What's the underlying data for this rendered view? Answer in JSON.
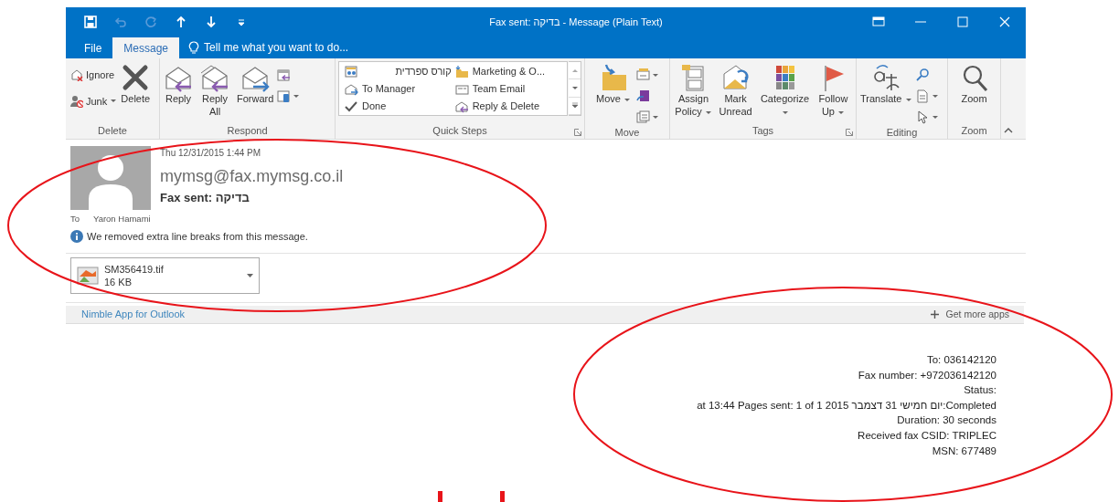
{
  "window": {
    "title": "Fax sent: בדיקה - Message (Plain Text)"
  },
  "quick_access": [
    {
      "disabled": false
    },
    {
      "disabled": true
    },
    {
      "disabled": true
    },
    {
      "disabled": false
    },
    {
      "disabled": false
    },
    {
      "disabled": false
    }
  ],
  "tabs": [
    {
      "label": "File",
      "selected": false
    },
    {
      "label": "Message",
      "selected": true
    }
  ],
  "tell_me": {
    "placeholder": "Tell me what you want to do..."
  },
  "ribbon": {
    "groups": [
      {
        "label": "Delete",
        "items": [
          {
            "kind": "smallstack",
            "items": [
              {
                "label": "Ignore",
                "dropdown": false
              },
              {
                "label": "Junk",
                "dropdown": true
              }
            ]
          },
          {
            "kind": "large",
            "label": "Delete",
            "dropdown": false
          }
        ]
      },
      {
        "label": "Respond",
        "items": [
          {
            "kind": "large",
            "label": "Reply",
            "dropdown": false
          },
          {
            "kind": "large",
            "label": "Reply All",
            "dropdown": false
          },
          {
            "kind": "large",
            "label": "Forward",
            "dropdown": false
          },
          {
            "kind": "iconstack",
            "items": [
              {
                "dropdown": false
              },
              {
                "dropdown": true
              }
            ]
          }
        ]
      },
      {
        "label": "Quick Steps",
        "launcher": true,
        "items": [
          {
            "kind": "gallery",
            "items": [
              {
                "label": "קורס ספרדית"
              },
              {
                "label": "Marketing & O..."
              },
              {
                "label": "To Manager"
              },
              {
                "label": "Team Email"
              },
              {
                "label": "Done"
              },
              {
                "label": "Reply & Delete"
              }
            ]
          }
        ]
      },
      {
        "label": "Move",
        "items": [
          {
            "kind": "large",
            "label": "Move",
            "dropdown": true
          },
          {
            "kind": "iconstack",
            "items": [
              {
                "dropdown": true
              },
              {
                "dropdown": false
              },
              {
                "dropdown": true
              }
            ]
          }
        ]
      },
      {
        "label": "Tags",
        "launcher": true,
        "items": [
          {
            "kind": "large",
            "label": "Assign Policy",
            "dropdown": true
          },
          {
            "kind": "large",
            "label": "Mark Unread",
            "dropdown": false
          },
          {
            "kind": "large",
            "label": "Categorize",
            "dropdown": true
          },
          {
            "kind": "large",
            "label": "Follow Up",
            "dropdown": true
          }
        ]
      },
      {
        "label": "Editing",
        "items": [
          {
            "kind": "large",
            "label": "Translate",
            "dropdown": true
          },
          {
            "kind": "iconstack",
            "items": [
              {
                "dropdown": false
              },
              {
                "dropdown": true
              },
              {
                "dropdown": true
              }
            ]
          }
        ]
      },
      {
        "label": "Zoom",
        "items": [
          {
            "kind": "large",
            "label": "Zoom",
            "dropdown": false
          }
        ]
      }
    ]
  },
  "message": {
    "date": "Thu 12/31/2015 1:44 PM",
    "from": "mymsg@fax.mymsg.co.il",
    "subject": "Fax sent: בדיקה",
    "to_label": "To",
    "to": "Yaron Hamami",
    "info": "We removed extra line breaks from this message.",
    "attachments": [
      {
        "name": "SM356419.tif",
        "size": "16 KB"
      }
    ]
  },
  "apps_bar": {
    "app": "Nimble App for Outlook",
    "get_more": "Get more apps"
  },
  "body": [
    {
      "text": "To: 036142120"
    },
    {
      "text": "Fax number: +972036142120"
    },
    {
      "text": "Status:"
    },
    {
      "text": "Completed:יום חמישי 31 דצמבר 2015 at 13:44 Pages sent: 1 of 1",
      "rtl": true
    },
    {
      "text": "Duration: 30 seconds"
    },
    {
      "text": "Received fax CSID: TRIPLEC"
    },
    {
      "text": "MSN: 677489"
    }
  ]
}
